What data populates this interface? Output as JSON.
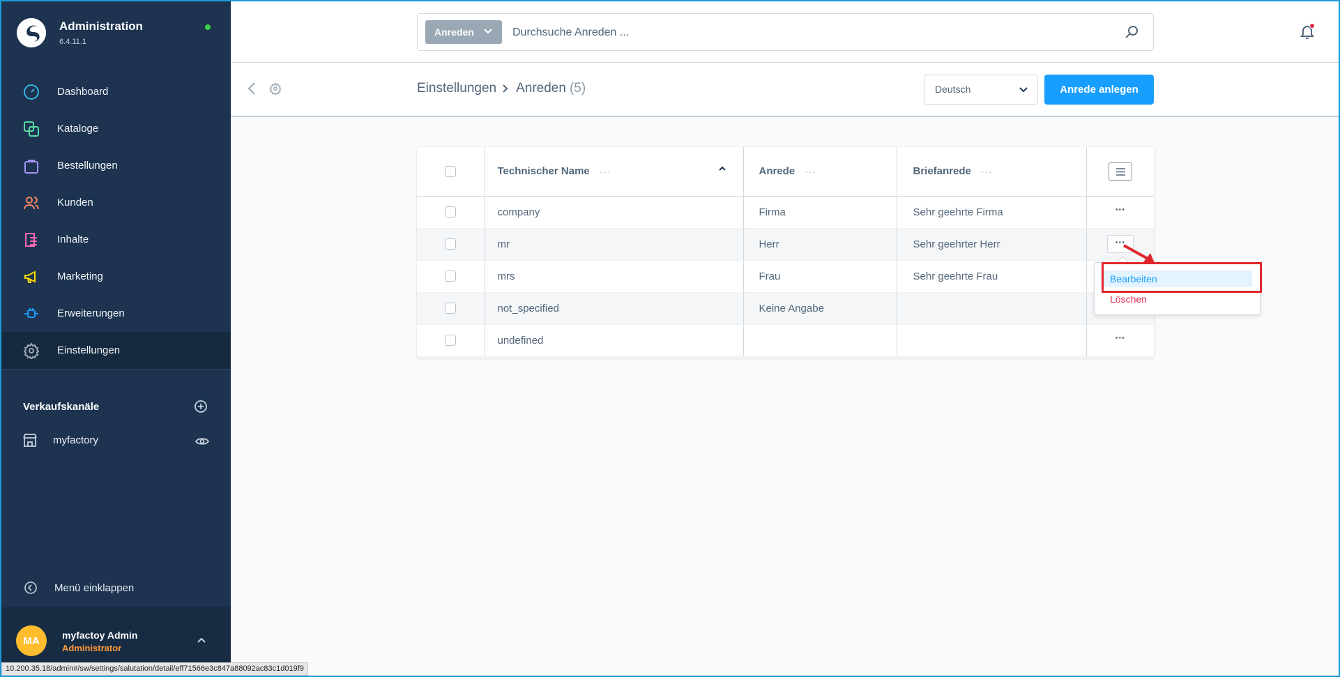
{
  "brand": {
    "title": "Administration",
    "version": "6.4.11.1"
  },
  "nav": [
    {
      "label": "Dashboard",
      "icon": "gauge-icon",
      "color": "#3ab0e0"
    },
    {
      "label": "Kataloge",
      "icon": "catalog-icon",
      "color": "#57d9a3"
    },
    {
      "label": "Bestellungen",
      "icon": "shopping-bag-icon",
      "color": "#a092f0"
    },
    {
      "label": "Kunden",
      "icon": "users-icon",
      "color": "#f88962"
    },
    {
      "label": "Inhalte",
      "icon": "content-icon",
      "color": "#ff68b4"
    },
    {
      "label": "Marketing",
      "icon": "megaphone-icon",
      "color": "#ffd700"
    },
    {
      "label": "Erweiterungen",
      "icon": "plug-icon",
      "color": "#189eff"
    },
    {
      "label": "Einstellungen",
      "icon": "gear-icon",
      "color": "#9aa8b5"
    }
  ],
  "sales_channels": {
    "title": "Verkaufskanäle",
    "items": [
      {
        "label": "myfactory"
      }
    ]
  },
  "collapse_label": "Menü einklappen",
  "user": {
    "initials": "MA",
    "name": "myfactoy Admin",
    "role": "Administrator"
  },
  "search": {
    "type_label": "Anreden",
    "placeholder": "Durchsuche Anreden ..."
  },
  "breadcrumb": {
    "parent": "Einstellungen",
    "current": "Anreden",
    "count": "(5)"
  },
  "language": {
    "selected": "Deutsch"
  },
  "primary_action": "Anrede anlegen",
  "grid": {
    "columns": {
      "name": "Technischer Name",
      "anrede": "Anrede",
      "brief": "Briefanrede"
    },
    "rows": [
      {
        "name": "company",
        "anrede": "Firma",
        "brief": "Sehr geehrte Firma"
      },
      {
        "name": "mr",
        "anrede": "Herr",
        "brief": "Sehr geehrter Herr"
      },
      {
        "name": "mrs",
        "anrede": "Frau",
        "brief": "Sehr geehrte Frau"
      },
      {
        "name": "not_specified",
        "anrede": "Keine Angabe",
        "brief": ""
      },
      {
        "name": "undefined",
        "anrede": "",
        "brief": ""
      }
    ]
  },
  "context_menu": {
    "edit": "Bearbeiten",
    "delete": "Löschen"
  },
  "status_url": "10.200.35.18/admin#/sw/settings/salutation/detail/eff71566e3c847a88092ac83c1d019f9",
  "colors": {
    "sidebar": "#1d3350",
    "accent": "#189eff",
    "danger": "#de294c",
    "highlight": "#e0262b"
  }
}
